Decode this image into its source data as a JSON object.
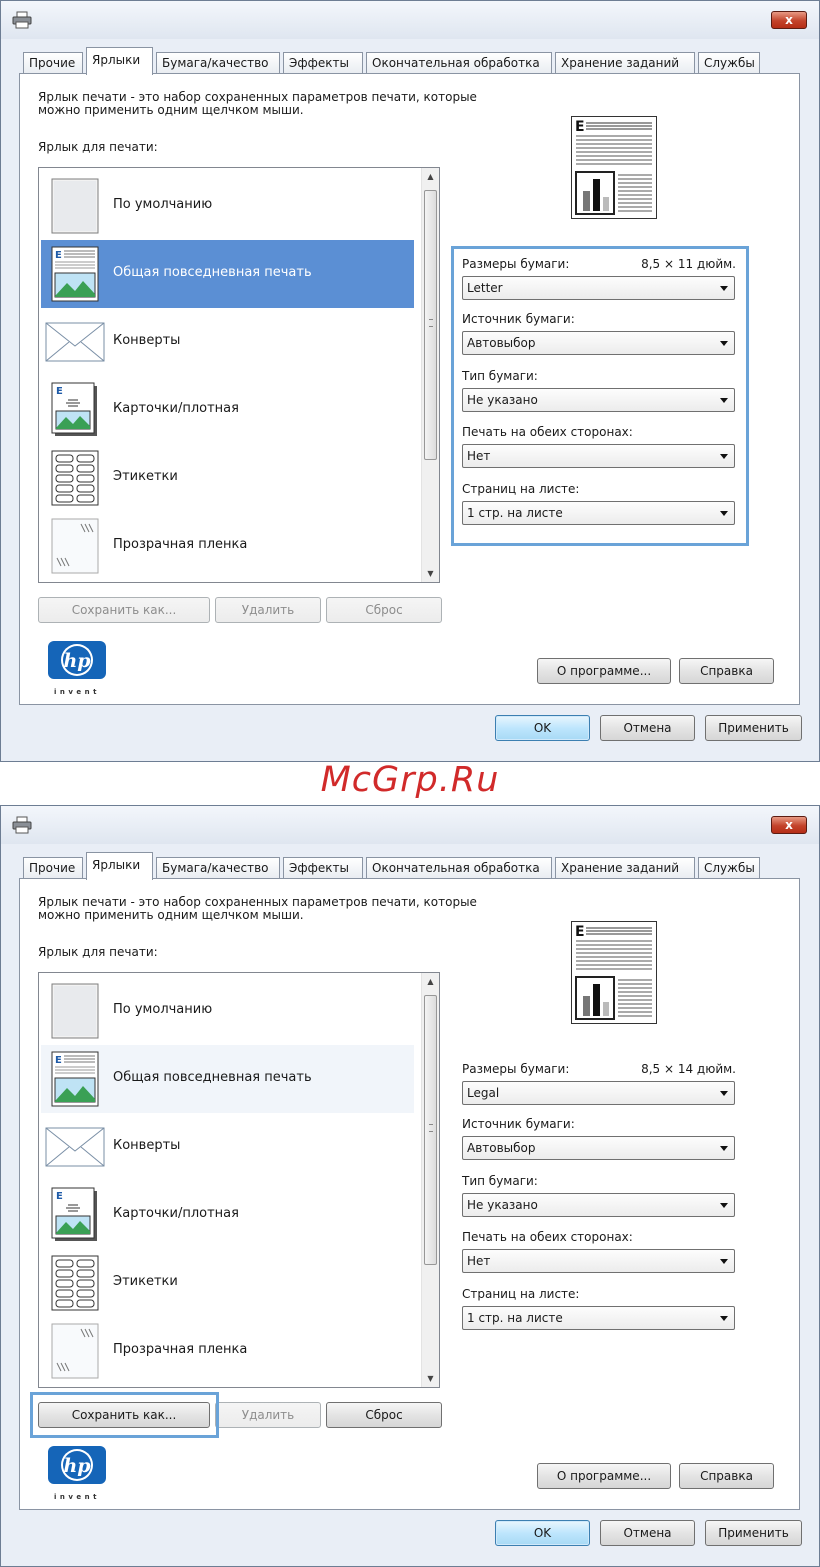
{
  "watermark": "McGrp.Ru",
  "dialogs": [
    {
      "close_label": "x",
      "tabs": [
        "Прочие",
        "Ярлыки",
        "Бумага/качество",
        "Эффекты",
        "Окончательная обработка",
        "Хранение заданий",
        "Службы"
      ],
      "active_tab": "Ярлыки",
      "description_line1": "Ярлык печати - это набор сохраненных параметров печати, которые",
      "description_line2": "можно применить одним щелчком мыши.",
      "list_label": "Ярлык для печати:",
      "shortcuts": [
        {
          "label": "По умолчанию",
          "icon": "blank-page-icon"
        },
        {
          "label": "Общая повседневная печать",
          "icon": "document-with-image-icon",
          "state": "selected"
        },
        {
          "label": "Конверты",
          "icon": "envelope-icon"
        },
        {
          "label": "Карточки/плотная",
          "icon": "card-icon"
        },
        {
          "label": "Этикетки",
          "icon": "labels-icon"
        },
        {
          "label": "Прозрачная пленка",
          "icon": "transparency-icon"
        }
      ],
      "save_as_label": "Сохранить как...",
      "delete_label": "Удалить",
      "reset_label": "Сброс",
      "about_label": "О программе...",
      "help_label": "Справка",
      "ok_label": "OK",
      "cancel_label": "Отмена",
      "apply_label": "Применить",
      "hp_invent": "invent",
      "paper_size_label": "Размеры бумаги:",
      "paper_size_value": "8,5 × 11 дюйм.",
      "paper_size_selected": "Letter",
      "paper_source_label": "Источник бумаги:",
      "paper_source_selected": "Автовыбор",
      "paper_type_label": "Тип бумаги:",
      "paper_type_selected": "Не указано",
      "duplex_label": "Печать на обеих сторонах:",
      "duplex_selected": "Нет",
      "pages_per_sheet_label": "Страниц на листе:",
      "pages_per_sheet_selected": "1 стр. на листе",
      "save_as_enabled": false,
      "reset_enabled": false,
      "highlight": "settings"
    },
    {
      "close_label": "x",
      "tabs": [
        "Прочие",
        "Ярлыки",
        "Бумага/качество",
        "Эффекты",
        "Окончательная обработка",
        "Хранение заданий",
        "Службы"
      ],
      "active_tab": "Ярлыки",
      "description_line1": "Ярлык печати - это набор сохраненных параметров печати, которые",
      "description_line2": "можно применить одним щелчком мыши.",
      "list_label": "Ярлык для печати:",
      "shortcuts": [
        {
          "label": "По умолчанию",
          "icon": "blank-page-icon"
        },
        {
          "label": "Общая повседневная печать",
          "icon": "document-with-image-icon",
          "state": "hover"
        },
        {
          "label": "Конверты",
          "icon": "envelope-icon"
        },
        {
          "label": "Карточки/плотная",
          "icon": "card-icon"
        },
        {
          "label": "Этикетки",
          "icon": "labels-icon"
        },
        {
          "label": "Прозрачная пленка",
          "icon": "transparency-icon"
        }
      ],
      "save_as_label": "Сохранить как...",
      "delete_label": "Удалить",
      "reset_label": "Сброс",
      "about_label": "О программе...",
      "help_label": "Справка",
      "ok_label": "OK",
      "cancel_label": "Отмена",
      "apply_label": "Применить",
      "hp_invent": "invent",
      "paper_size_label": "Размеры бумаги:",
      "paper_size_value": "8,5 × 14 дюйм.",
      "paper_size_selected": "Legal",
      "paper_source_label": "Источник бумаги:",
      "paper_source_selected": "Автовыбор",
      "paper_type_label": "Тип бумаги:",
      "paper_type_selected": "Не указано",
      "duplex_label": "Печать на обеих сторонах:",
      "duplex_selected": "Нет",
      "pages_per_sheet_label": "Страниц на листе:",
      "pages_per_sheet_selected": "1 стр. на листе",
      "save_as_enabled": true,
      "reset_enabled": true,
      "highlight": "save-as"
    }
  ],
  "colors": {
    "selection": "#5b8fd4",
    "highlight_box": "#6aa3d8",
    "watermark": "#d12a2a",
    "dialog_bg": "#e9eef6"
  }
}
